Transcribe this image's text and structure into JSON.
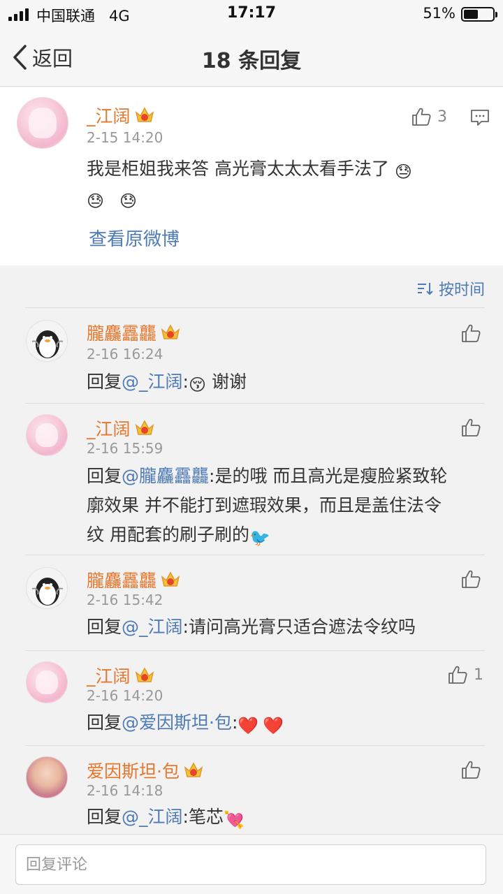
{
  "status_bar": {
    "carrier": "中国联通",
    "network": "4G",
    "time": "17:17",
    "battery": "51%",
    "battery_level": 0.51
  },
  "nav": {
    "back_label": "返回",
    "title": "18 条回复"
  },
  "main_comment": {
    "username": "_江阔",
    "time": "2-15 14:20",
    "likes": "3",
    "text_line1": "我是柜姐我来答   高光膏太太太看手法了",
    "view_original": "查看原微博",
    "emoji": "😓"
  },
  "sort": {
    "label": "按时间"
  },
  "replies": [
    {
      "username": "朧麤靐龘",
      "time": "2-16 16:24",
      "prefix": "回复",
      "mention": "@_江阔",
      "line1": ":",
      "emoji_a": "😚",
      "line1b": " 谢谢",
      "likes": ""
    },
    {
      "username": "_江阔",
      "time": "2-16 15:59",
      "prefix": "回复",
      "mention": "@朧麤靐龘",
      "line1": ":是的哦  而且高光是瘦脸紧致轮",
      "line2": "廓效果 并不能打到遮瑕效果，而且是盖住法令",
      "line3": "纹  用配套的刷子刷的",
      "emoji_a": "🐦",
      "likes": ""
    },
    {
      "username": "朧麤靐龘",
      "time": "2-16 15:42",
      "prefix": "回复",
      "mention": "@_江阔",
      "line1": ":请问高光膏只适合遮法令纹吗",
      "likes": ""
    },
    {
      "username": "_江阔",
      "time": "2-16 14:20",
      "prefix": "回复",
      "mention": "@爱因斯坦·包",
      "line1": ":",
      "emoji_a": "❤️",
      "emoji_b": "❤️",
      "likes": "1"
    },
    {
      "username": "爱因斯坦·包",
      "time": "2-16 14:18",
      "prefix": "回复",
      "mention": "@_江阔",
      "line1": ":笔芯",
      "emoji_a": "💘",
      "likes": ""
    }
  ],
  "input": {
    "placeholder": "回复评论"
  },
  "colors": {
    "username": "#e5772d",
    "link": "#4e7ab5",
    "timestamp": "#999999"
  }
}
